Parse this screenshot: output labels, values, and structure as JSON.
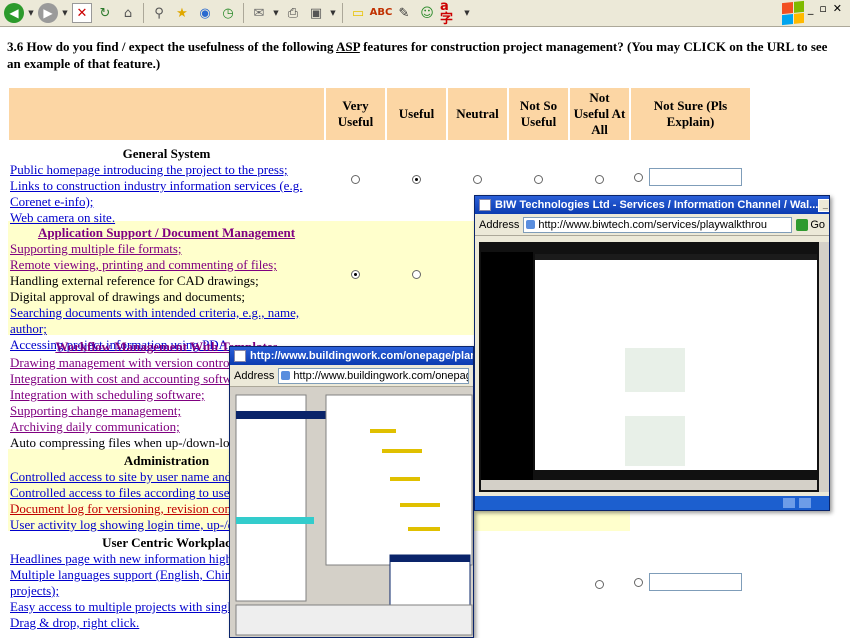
{
  "question": {
    "number": "3.6",
    "before": "How do you find / expect the usefulness of the following ",
    "asp": "ASP",
    "after": " features for construction project management? (You may CLICK on the URL to see an example of that feature.)"
  },
  "columns": [
    "Very Useful",
    "Useful",
    "Neutral",
    "Not So Useful",
    "Not Useful At All",
    "Not Sure (Pls Explain)"
  ],
  "sections": [
    {
      "title": "General System",
      "items": [
        "Public homepage introducing the project to the press;",
        "Links to construction industry information services (e.g. Corenet e-info);",
        "Web camera on site."
      ]
    },
    {
      "title": "Application Support / Document Management",
      "items": [
        "Supporting multiple file formats;",
        "Remote viewing, printing and commenting of files;",
        "Handling external reference for CAD drawings;",
        "Digital approval of drawings and documents;",
        "Searching documents with intended criteria, e.g., name, author;",
        "Accessing project information using PDA."
      ]
    },
    {
      "title": "Workflow Management With Templates",
      "items": [
        "Drawing management with version control;",
        "Integration with cost and accounting softwa",
        "Integration with scheduling software;",
        "Supporting change management;",
        "Archiving daily communication;",
        "Auto compressing files when up-/down-load"
      ]
    },
    {
      "title": "Administration",
      "items": [
        "Controlled access to site by user name and",
        "Controlled access to files according to user'",
        "Document log for versioning, revision contr",
        "User activity log showing login time, up-/do"
      ]
    },
    {
      "title": "User Centric Workplac",
      "items": [
        "Headlines page with new information highlig",
        "Multiple languages support (English, Chines international projects);",
        "Easy access to multiple projects with single",
        "Drag & drop, right click."
      ]
    }
  ],
  "selected": {
    "general_system": "Useful",
    "document_management": "Very Useful"
  },
  "popup_biw": {
    "title": "BIW Technologies Ltd - Services / Information Channel / Wal...",
    "address_label": "Address",
    "url": "http://www.biwtech.com/services/playwalkthrou",
    "go_label": "Go"
  },
  "popup_bw": {
    "title": "http://www.buildingwork.com/onepage/planning",
    "address_label": "Address",
    "url": "http://www.buildingwork.com/onepage/planni"
  }
}
